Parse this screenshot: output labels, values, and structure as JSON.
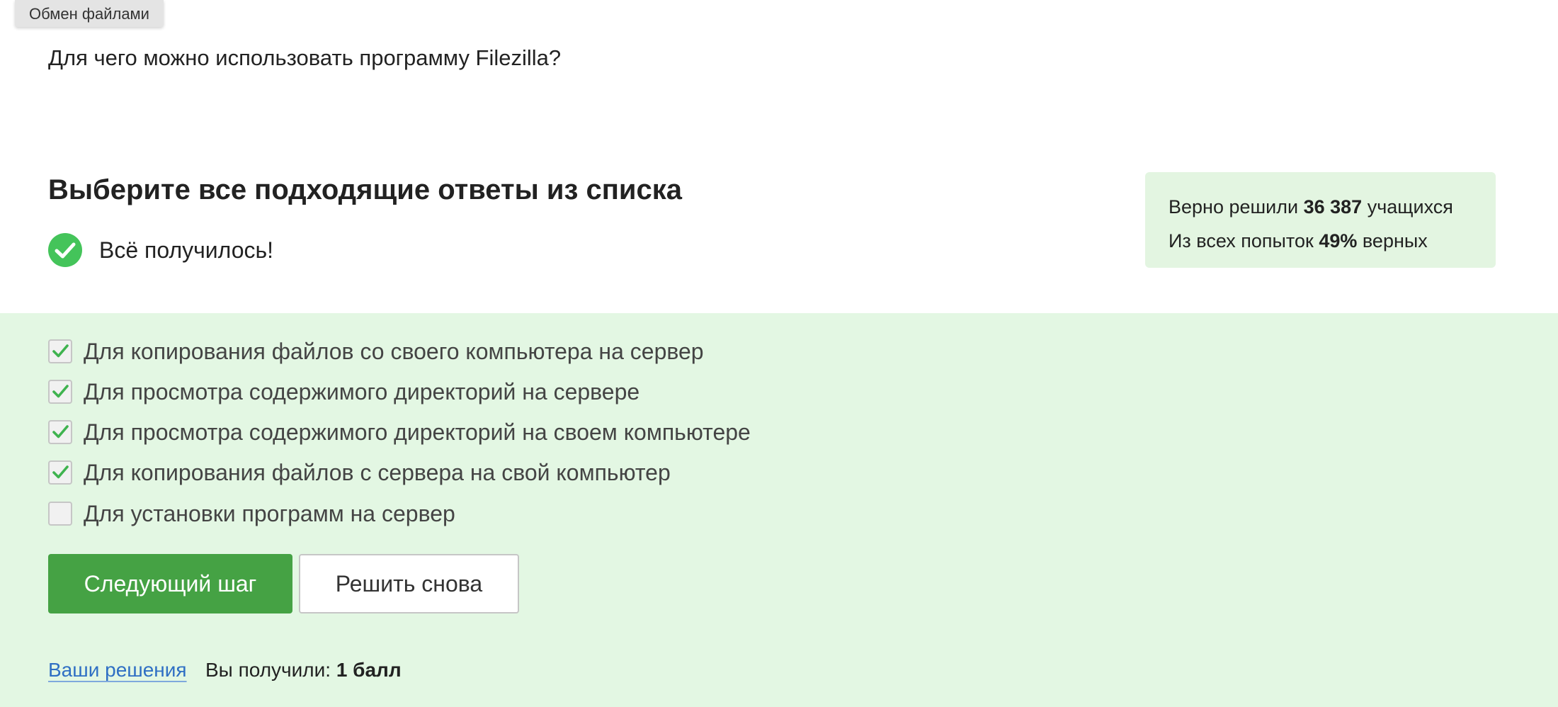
{
  "tooltip": {
    "label": "Обмен файлами"
  },
  "question": {
    "text": "Для чего можно использовать программу Filezilla?"
  },
  "instruction": "Выберите все подходящие ответы из списка",
  "result": {
    "text": "Всё получилось!",
    "icon": "check-circle-icon",
    "color": "#44c45a"
  },
  "stats": {
    "solved_prefix": "Верно решили",
    "solved_count": "36 387",
    "solved_suffix": "учащихся",
    "attempts_prefix": "Из всех попыток",
    "attempts_percent": "49%",
    "attempts_suffix": "верных"
  },
  "options": [
    {
      "label": "Для копирования файлов со своего компьютера на сервер",
      "checked": true
    },
    {
      "label": "Для просмотра содержимого директорий на сервере",
      "checked": true
    },
    {
      "label": "Для просмотра содержимого директорий на своем компьютере",
      "checked": true
    },
    {
      "label": "Для копирования файлов с сервера на свой компьютер",
      "checked": true
    },
    {
      "label": "Для установки программ на сервер",
      "checked": false
    }
  ],
  "buttons": {
    "next": "Следующий шаг",
    "retry": "Решить снова"
  },
  "footer": {
    "solutions_link": "Ваши решения",
    "score_prefix": "Вы получили:",
    "score_value": "1 балл"
  },
  "colors": {
    "accent": "#45a244",
    "answer_background": "#e3f7e3",
    "stats_background": "#e3f5e1",
    "link": "#2f6fc4"
  }
}
